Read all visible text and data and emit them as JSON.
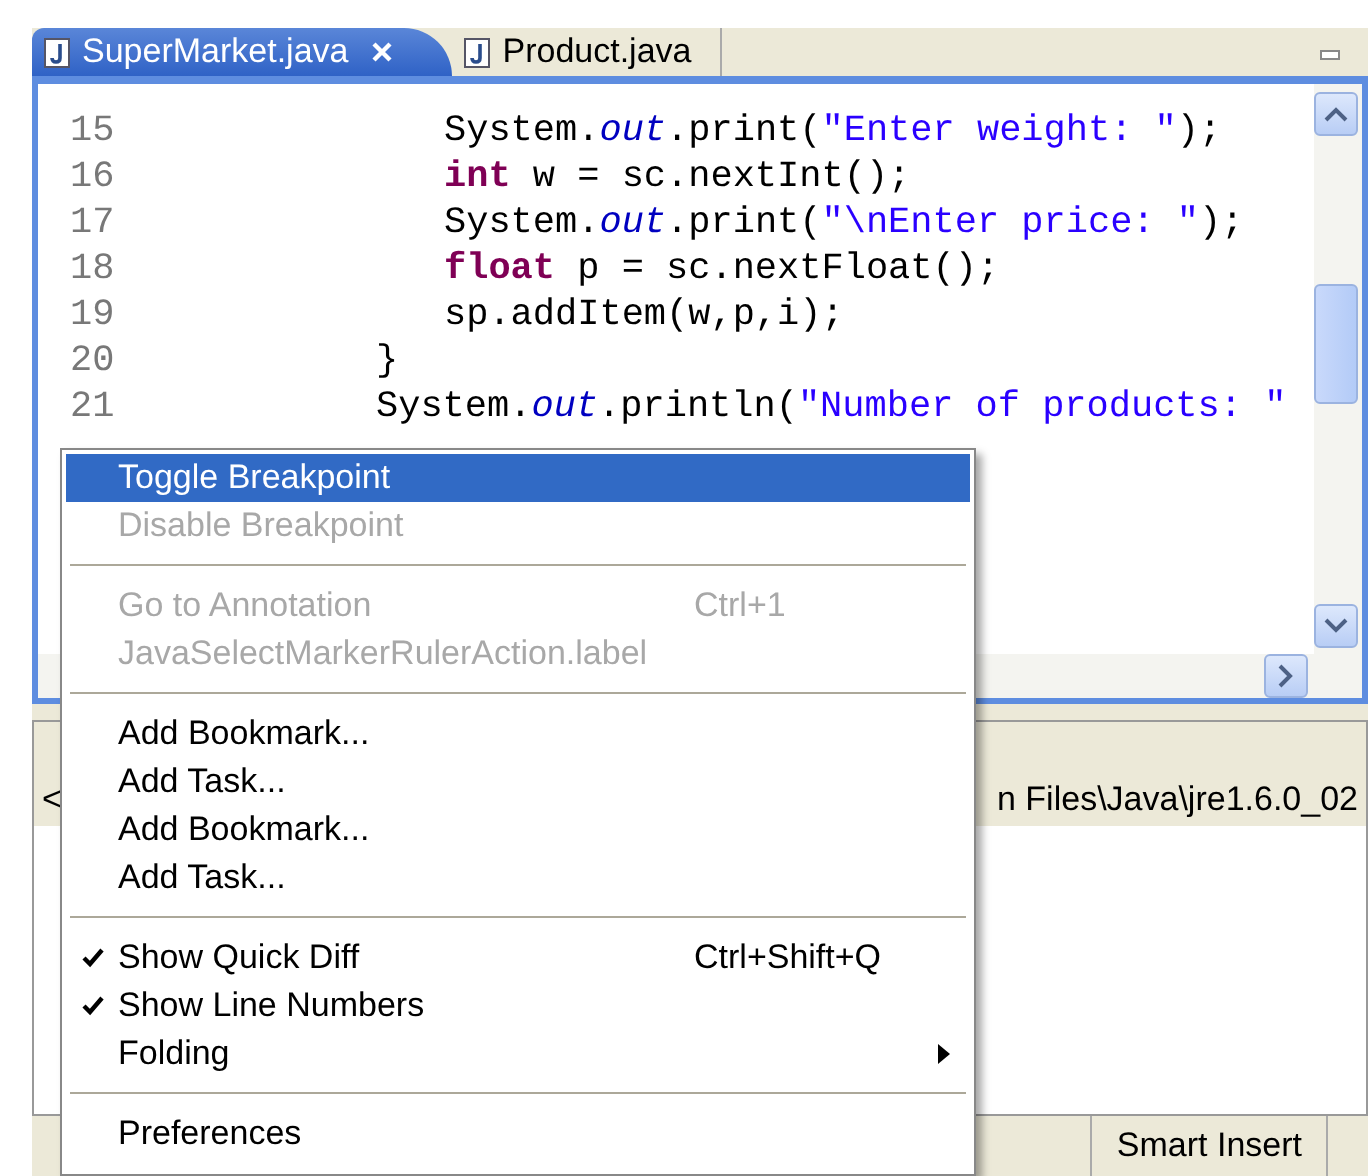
{
  "editor_tabs": [
    {
      "label": "SuperMarket.java",
      "selected": true,
      "closable": true
    },
    {
      "label": "Product.java",
      "selected": false,
      "closable": false
    }
  ],
  "code_lines": [
    {
      "number": "15",
      "kind": "inner",
      "tokens": [
        {
          "kind": "plain",
          "text": "System."
        },
        {
          "kind": "field",
          "text": "out"
        },
        {
          "kind": "plain",
          "text": ".print("
        },
        {
          "kind": "string",
          "text": "\"Enter weight: \""
        },
        {
          "kind": "plain",
          "text": ");"
        }
      ]
    },
    {
      "number": "16",
      "kind": "inner",
      "tokens": [
        {
          "kind": "keyword",
          "text": "int"
        },
        {
          "kind": "plain",
          "text": " w = sc.nextInt();"
        }
      ]
    },
    {
      "number": "17",
      "kind": "inner",
      "tokens": [
        {
          "kind": "plain",
          "text": "System."
        },
        {
          "kind": "field",
          "text": "out"
        },
        {
          "kind": "plain",
          "text": ".print("
        },
        {
          "kind": "string",
          "text": "\"\\nEnter price: \""
        },
        {
          "kind": "plain",
          "text": ");"
        }
      ]
    },
    {
      "number": "18",
      "kind": "inner",
      "tokens": [
        {
          "kind": "keyword",
          "text": "float"
        },
        {
          "kind": "plain",
          "text": " p = sc.nextFloat();"
        }
      ]
    },
    {
      "number": "19",
      "kind": "inner",
      "tokens": [
        {
          "kind": "plain",
          "text": "sp.addItem(w,p,i);"
        }
      ]
    },
    {
      "number": "20",
      "kind": "outer",
      "tokens": [
        {
          "kind": "plain",
          "text": "}"
        }
      ]
    },
    {
      "number": "21",
      "kind": "outer",
      "tokens": [
        {
          "kind": "plain",
          "text": "System."
        },
        {
          "kind": "field",
          "text": "out"
        },
        {
          "kind": "plain",
          "text": ".println("
        },
        {
          "kind": "string",
          "text": "\"Number of products: \""
        }
      ]
    }
  ],
  "console": {
    "left_mark": "<",
    "path": "n Files\\Java\\jre1.6.0_02"
  },
  "status_bar": {
    "insert_mode": "Smart Insert"
  },
  "context_menu": [
    {
      "kind": "item",
      "label": "Toggle Breakpoint",
      "submenu": false,
      "selected": true,
      "disabled": false,
      "checked": false
    },
    {
      "kind": "item",
      "label": "Disable Breakpoint",
      "submenu": false,
      "selected": false,
      "disabled": true,
      "checked": false
    },
    {
      "kind": "separator"
    },
    {
      "kind": "item",
      "label": "Go to Annotation",
      "shortcut": "Ctrl+1",
      "submenu": false,
      "selected": false,
      "disabled": true,
      "checked": false
    },
    {
      "kind": "item",
      "label": "JavaSelectMarkerRulerAction.label",
      "submenu": false,
      "selected": false,
      "disabled": true,
      "checked": false
    },
    {
      "kind": "separator"
    },
    {
      "kind": "item",
      "label": "Add Bookmark...",
      "submenu": false,
      "selected": false,
      "disabled": false,
      "checked": false
    },
    {
      "kind": "item",
      "label": "Add Task...",
      "submenu": false,
      "selected": false,
      "disabled": false,
      "checked": false
    },
    {
      "kind": "item",
      "label": "Add Bookmark...",
      "submenu": false,
      "selected": false,
      "disabled": false,
      "checked": false
    },
    {
      "kind": "item",
      "label": "Add Task...",
      "submenu": false,
      "selected": false,
      "disabled": false,
      "checked": false
    },
    {
      "kind": "separator"
    },
    {
      "kind": "item",
      "label": "Show Quick Diff",
      "shortcut": "Ctrl+Shift+Q",
      "submenu": false,
      "selected": false,
      "disabled": false,
      "checked": true
    },
    {
      "kind": "item",
      "label": "Show Line Numbers",
      "submenu": false,
      "selected": false,
      "disabled": false,
      "checked": true
    },
    {
      "kind": "item",
      "label": "Folding",
      "submenu": true,
      "selected": false,
      "disabled": false,
      "checked": false
    },
    {
      "kind": "separator"
    },
    {
      "kind": "item",
      "label": "Preferences",
      "submenu": false,
      "selected": false,
      "disabled": false,
      "checked": false
    }
  ]
}
